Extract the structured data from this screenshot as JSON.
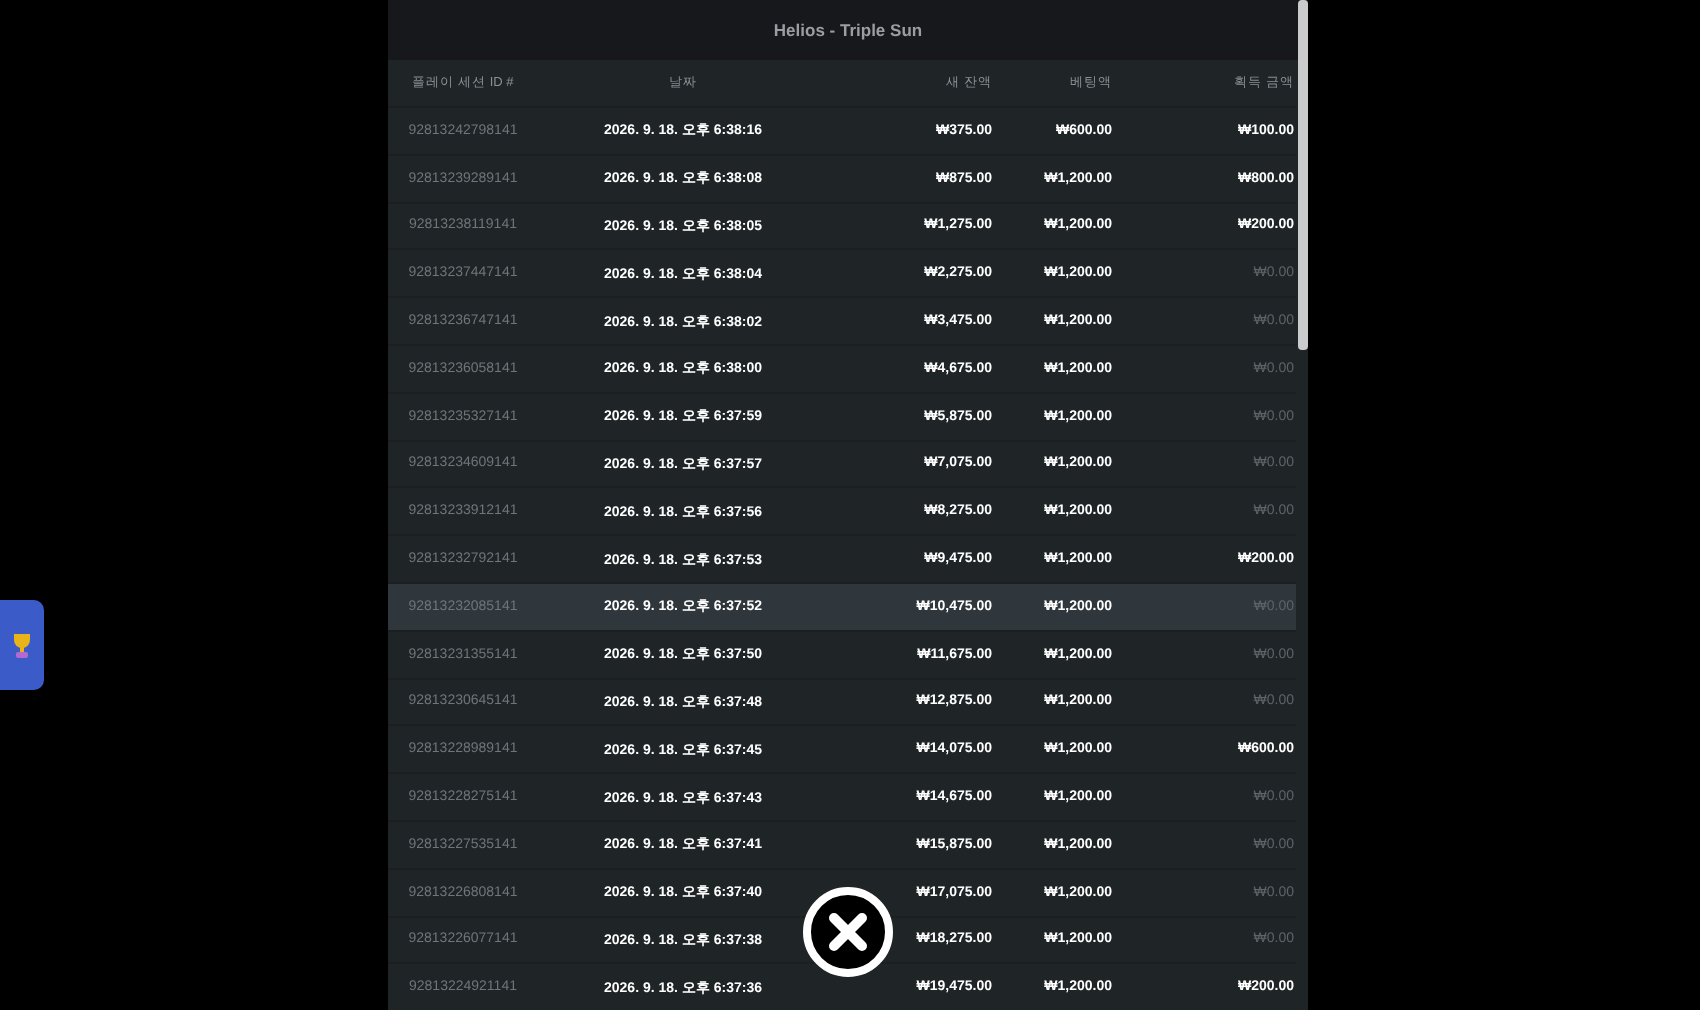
{
  "window": {
    "title": "Helios - Triple Sun"
  },
  "table": {
    "columns": [
      "플레이 세션 ID #",
      "날짜",
      "새 잔액",
      "베팅액",
      "획득 금액"
    ],
    "rows": [
      {
        "session_id": "92813242798141",
        "date": "2026. 9. 18. 오후 6:38:16",
        "balance": "₩375.00",
        "bet": "₩600.00",
        "win": "₩100.00",
        "win_muted": false,
        "highlighted": false
      },
      {
        "session_id": "92813239289141",
        "date": "2026. 9. 18. 오후 6:38:08",
        "balance": "₩875.00",
        "bet": "₩1,200.00",
        "win": "₩800.00",
        "win_muted": false,
        "highlighted": false
      },
      {
        "session_id": "92813238119141",
        "date": "2026. 9. 18. 오후 6:38:05",
        "balance": "₩1,275.00",
        "bet": "₩1,200.00",
        "win": "₩200.00",
        "win_muted": false,
        "highlighted": false
      },
      {
        "session_id": "92813237447141",
        "date": "2026. 9. 18. 오후 6:38:04",
        "balance": "₩2,275.00",
        "bet": "₩1,200.00",
        "win": "₩0.00",
        "win_muted": true,
        "highlighted": false
      },
      {
        "session_id": "92813236747141",
        "date": "2026. 9. 18. 오후 6:38:02",
        "balance": "₩3,475.00",
        "bet": "₩1,200.00",
        "win": "₩0.00",
        "win_muted": true,
        "highlighted": false
      },
      {
        "session_id": "92813236058141",
        "date": "2026. 9. 18. 오후 6:38:00",
        "balance": "₩4,675.00",
        "bet": "₩1,200.00",
        "win": "₩0.00",
        "win_muted": true,
        "highlighted": false
      },
      {
        "session_id": "92813235327141",
        "date": "2026. 9. 18. 오후 6:37:59",
        "balance": "₩5,875.00",
        "bet": "₩1,200.00",
        "win": "₩0.00",
        "win_muted": true,
        "highlighted": false
      },
      {
        "session_id": "92813234609141",
        "date": "2026. 9. 18. 오후 6:37:57",
        "balance": "₩7,075.00",
        "bet": "₩1,200.00",
        "win": "₩0.00",
        "win_muted": true,
        "highlighted": false
      },
      {
        "session_id": "92813233912141",
        "date": "2026. 9. 18. 오후 6:37:56",
        "balance": "₩8,275.00",
        "bet": "₩1,200.00",
        "win": "₩0.00",
        "win_muted": true,
        "highlighted": false
      },
      {
        "session_id": "92813232792141",
        "date": "2026. 9. 18. 오후 6:37:53",
        "balance": "₩9,475.00",
        "bet": "₩1,200.00",
        "win": "₩200.00",
        "win_muted": false,
        "highlighted": false
      },
      {
        "session_id": "92813232085141",
        "date": "2026. 9. 18. 오후 6:37:52",
        "balance": "₩10,475.00",
        "bet": "₩1,200.00",
        "win": "₩0.00",
        "win_muted": true,
        "highlighted": true
      },
      {
        "session_id": "92813231355141",
        "date": "2026. 9. 18. 오후 6:37:50",
        "balance": "₩11,675.00",
        "bet": "₩1,200.00",
        "win": "₩0.00",
        "win_muted": true,
        "highlighted": false
      },
      {
        "session_id": "92813230645141",
        "date": "2026. 9. 18. 오후 6:37:48",
        "balance": "₩12,875.00",
        "bet": "₩1,200.00",
        "win": "₩0.00",
        "win_muted": true,
        "highlighted": false
      },
      {
        "session_id": "92813228989141",
        "date": "2026. 9. 18. 오후 6:37:45",
        "balance": "₩14,075.00",
        "bet": "₩1,200.00",
        "win": "₩600.00",
        "win_muted": false,
        "highlighted": false
      },
      {
        "session_id": "92813228275141",
        "date": "2026. 9. 18. 오후 6:37:43",
        "balance": "₩14,675.00",
        "bet": "₩1,200.00",
        "win": "₩0.00",
        "win_muted": true,
        "highlighted": false
      },
      {
        "session_id": "92813227535141",
        "date": "2026. 9. 18. 오후 6:37:41",
        "balance": "₩15,875.00",
        "bet": "₩1,200.00",
        "win": "₩0.00",
        "win_muted": true,
        "highlighted": false
      },
      {
        "session_id": "92813226808141",
        "date": "2026. 9. 18. 오후 6:37:40",
        "balance": "₩17,075.00",
        "bet": "₩1,200.00",
        "win": "₩0.00",
        "win_muted": true,
        "highlighted": false
      },
      {
        "session_id": "92813226077141",
        "date": "2026. 9. 18. 오후 6:37:38",
        "balance": "₩18,275.00",
        "bet": "₩1,200.00",
        "win": "₩0.00",
        "win_muted": true,
        "highlighted": false
      },
      {
        "session_id": "92813224921141",
        "date": "2026. 9. 18. 오후 6:37:36",
        "balance": "₩19,475.00",
        "bet": "₩1,200.00",
        "win": "₩200.00",
        "win_muted": false,
        "highlighted": false
      }
    ]
  }
}
